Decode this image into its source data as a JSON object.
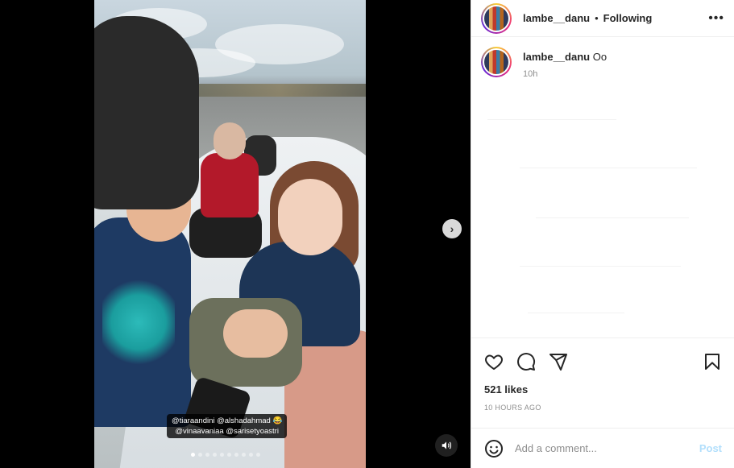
{
  "post": {
    "username": "lambe__danu",
    "separator": "•",
    "follow_status": "Following",
    "more_label": "•••",
    "caption": {
      "username": "lambe__danu",
      "text": "Oo",
      "time": "10h"
    },
    "likes": "521 likes",
    "time_ago": "10 HOURS AGO"
  },
  "media": {
    "tags": [
      "@tiaraandini @alshadahmad 😂",
      "@vinaavaniaa @sarisetyoastri"
    ],
    "carousel": {
      "count": 10,
      "active_index": 0
    },
    "next_label": "›"
  },
  "comment_box": {
    "placeholder": "Add a comment...",
    "post_label": "Post"
  },
  "icons": {
    "heart": "heart-icon",
    "comment": "comment-icon",
    "share": "share-icon",
    "save": "bookmark-icon",
    "emoji": "emoji-icon",
    "more": "more-icon",
    "mute": "speaker-icon",
    "next": "chevron-right-icon"
  },
  "colors": {
    "post_link": "#b2dffc",
    "text": "#262626",
    "secondary": "#8e8e8e"
  }
}
